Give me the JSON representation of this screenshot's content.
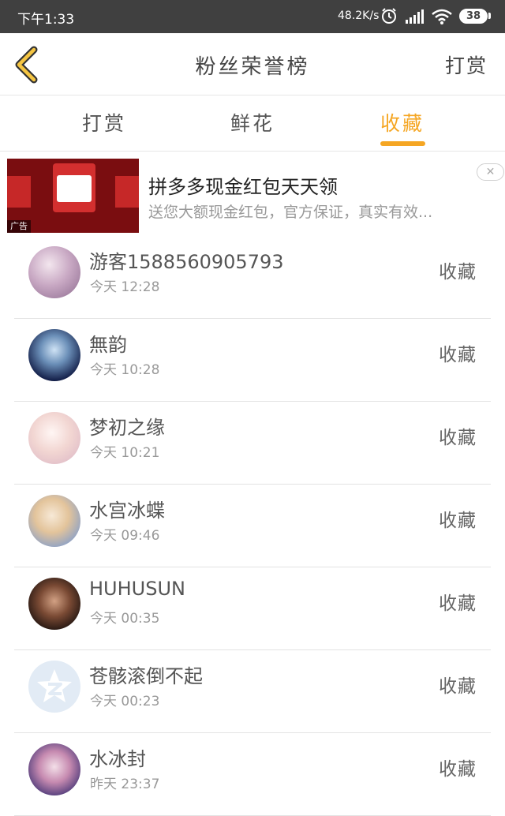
{
  "status_bar": {
    "time": "下午1:33",
    "net_speed": "48.2K/s",
    "battery": "38",
    "icons": [
      "alarm-icon",
      "signal-icon",
      "wifi-icon",
      "battery-icon"
    ]
  },
  "header": {
    "title": "粉丝荣誉榜",
    "action": "打赏",
    "back_icon": "chevron-left-icon"
  },
  "tabs": [
    {
      "label": "打赏",
      "active": false
    },
    {
      "label": "鲜花",
      "active": false
    },
    {
      "label": "收藏",
      "active": true
    }
  ],
  "ad": {
    "title": "拼多多现金红包天天领",
    "description": "送您大额现金红包，官方保证，真实有效...",
    "tag": "广告",
    "close_icon": "close-icon"
  },
  "list": [
    {
      "name": "游客1588560905793",
      "time": "今天 12:28",
      "action": "收藏"
    },
    {
      "name": "無韵",
      "time": "今天 10:28",
      "action": "收藏"
    },
    {
      "name": "梦初之缘",
      "time": "今天 10:21",
      "action": "收藏"
    },
    {
      "name": "水宫冰蝶",
      "time": "今天 09:46",
      "action": "收藏"
    },
    {
      "name": "HUHUSUN",
      "time": "今天 00:35",
      "action": "收藏"
    },
    {
      "name": "苍骸滚倒不起",
      "time": "今天 00:23",
      "action": "收藏"
    },
    {
      "name": "水冰封",
      "time": "昨天 23:37",
      "action": "收藏"
    }
  ],
  "colors": {
    "accent": "#f5a623",
    "status_bar": "#404040",
    "divider": "#e6e6e6"
  }
}
